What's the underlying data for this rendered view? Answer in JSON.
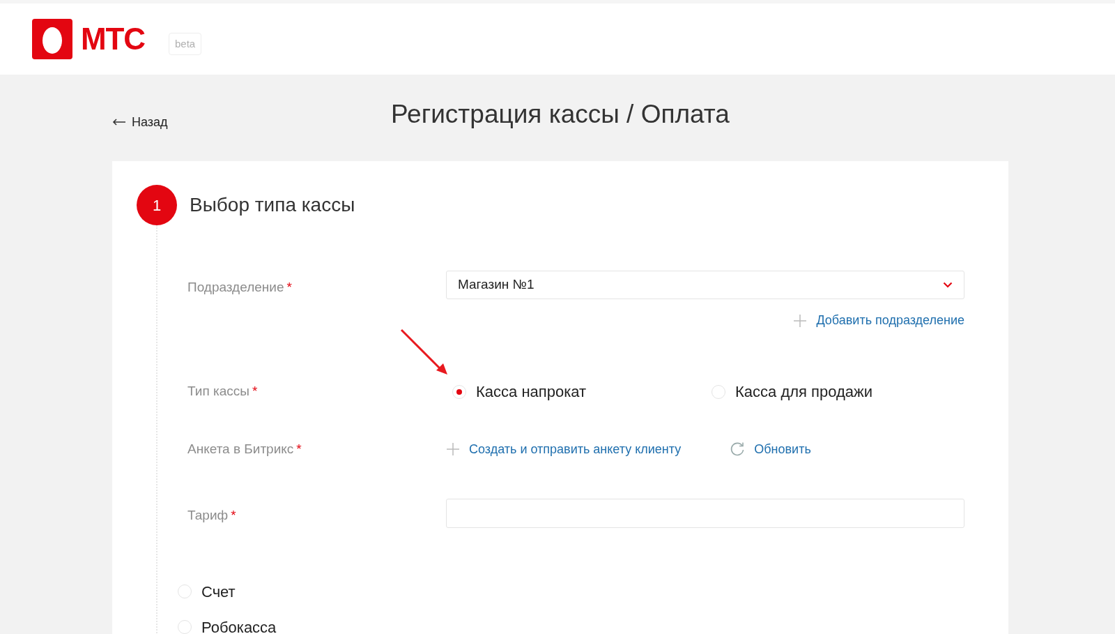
{
  "header": {
    "logo_text": "МТС",
    "badge": "beta"
  },
  "back_link": "Назад",
  "page_title": "Регистрация кассы / Оплата",
  "step": {
    "number": "1",
    "title": "Выбор типа кассы"
  },
  "fields": [
    {
      "kind": "select",
      "label": "Подразделение",
      "mark": "*",
      "value": "Магазин №1",
      "action": "Добавить подразделение"
    },
    {
      "kind": "radio",
      "label": "Тип кассы",
      "mark": "*",
      "options": [
        {
          "label": "Касса напрокат",
          "selected": true
        },
        {
          "label": "Касса для продажи",
          "selected": false
        }
      ]
    },
    {
      "kind": "links",
      "label": "Анкета в Битрикс",
      "mark": "*",
      "links": [
        {
          "kind": "create",
          "label": "Создать и отправить анкету клиенту"
        },
        {
          "kind": "refresh",
          "label": "Обновить"
        }
      ]
    },
    {
      "kind": "input",
      "label": "Тариф",
      "mark": "*"
    }
  ],
  "payment_options": [
    {
      "label": "Счет",
      "selected": false
    },
    {
      "label": "Робокасса",
      "selected": false
    }
  ]
}
